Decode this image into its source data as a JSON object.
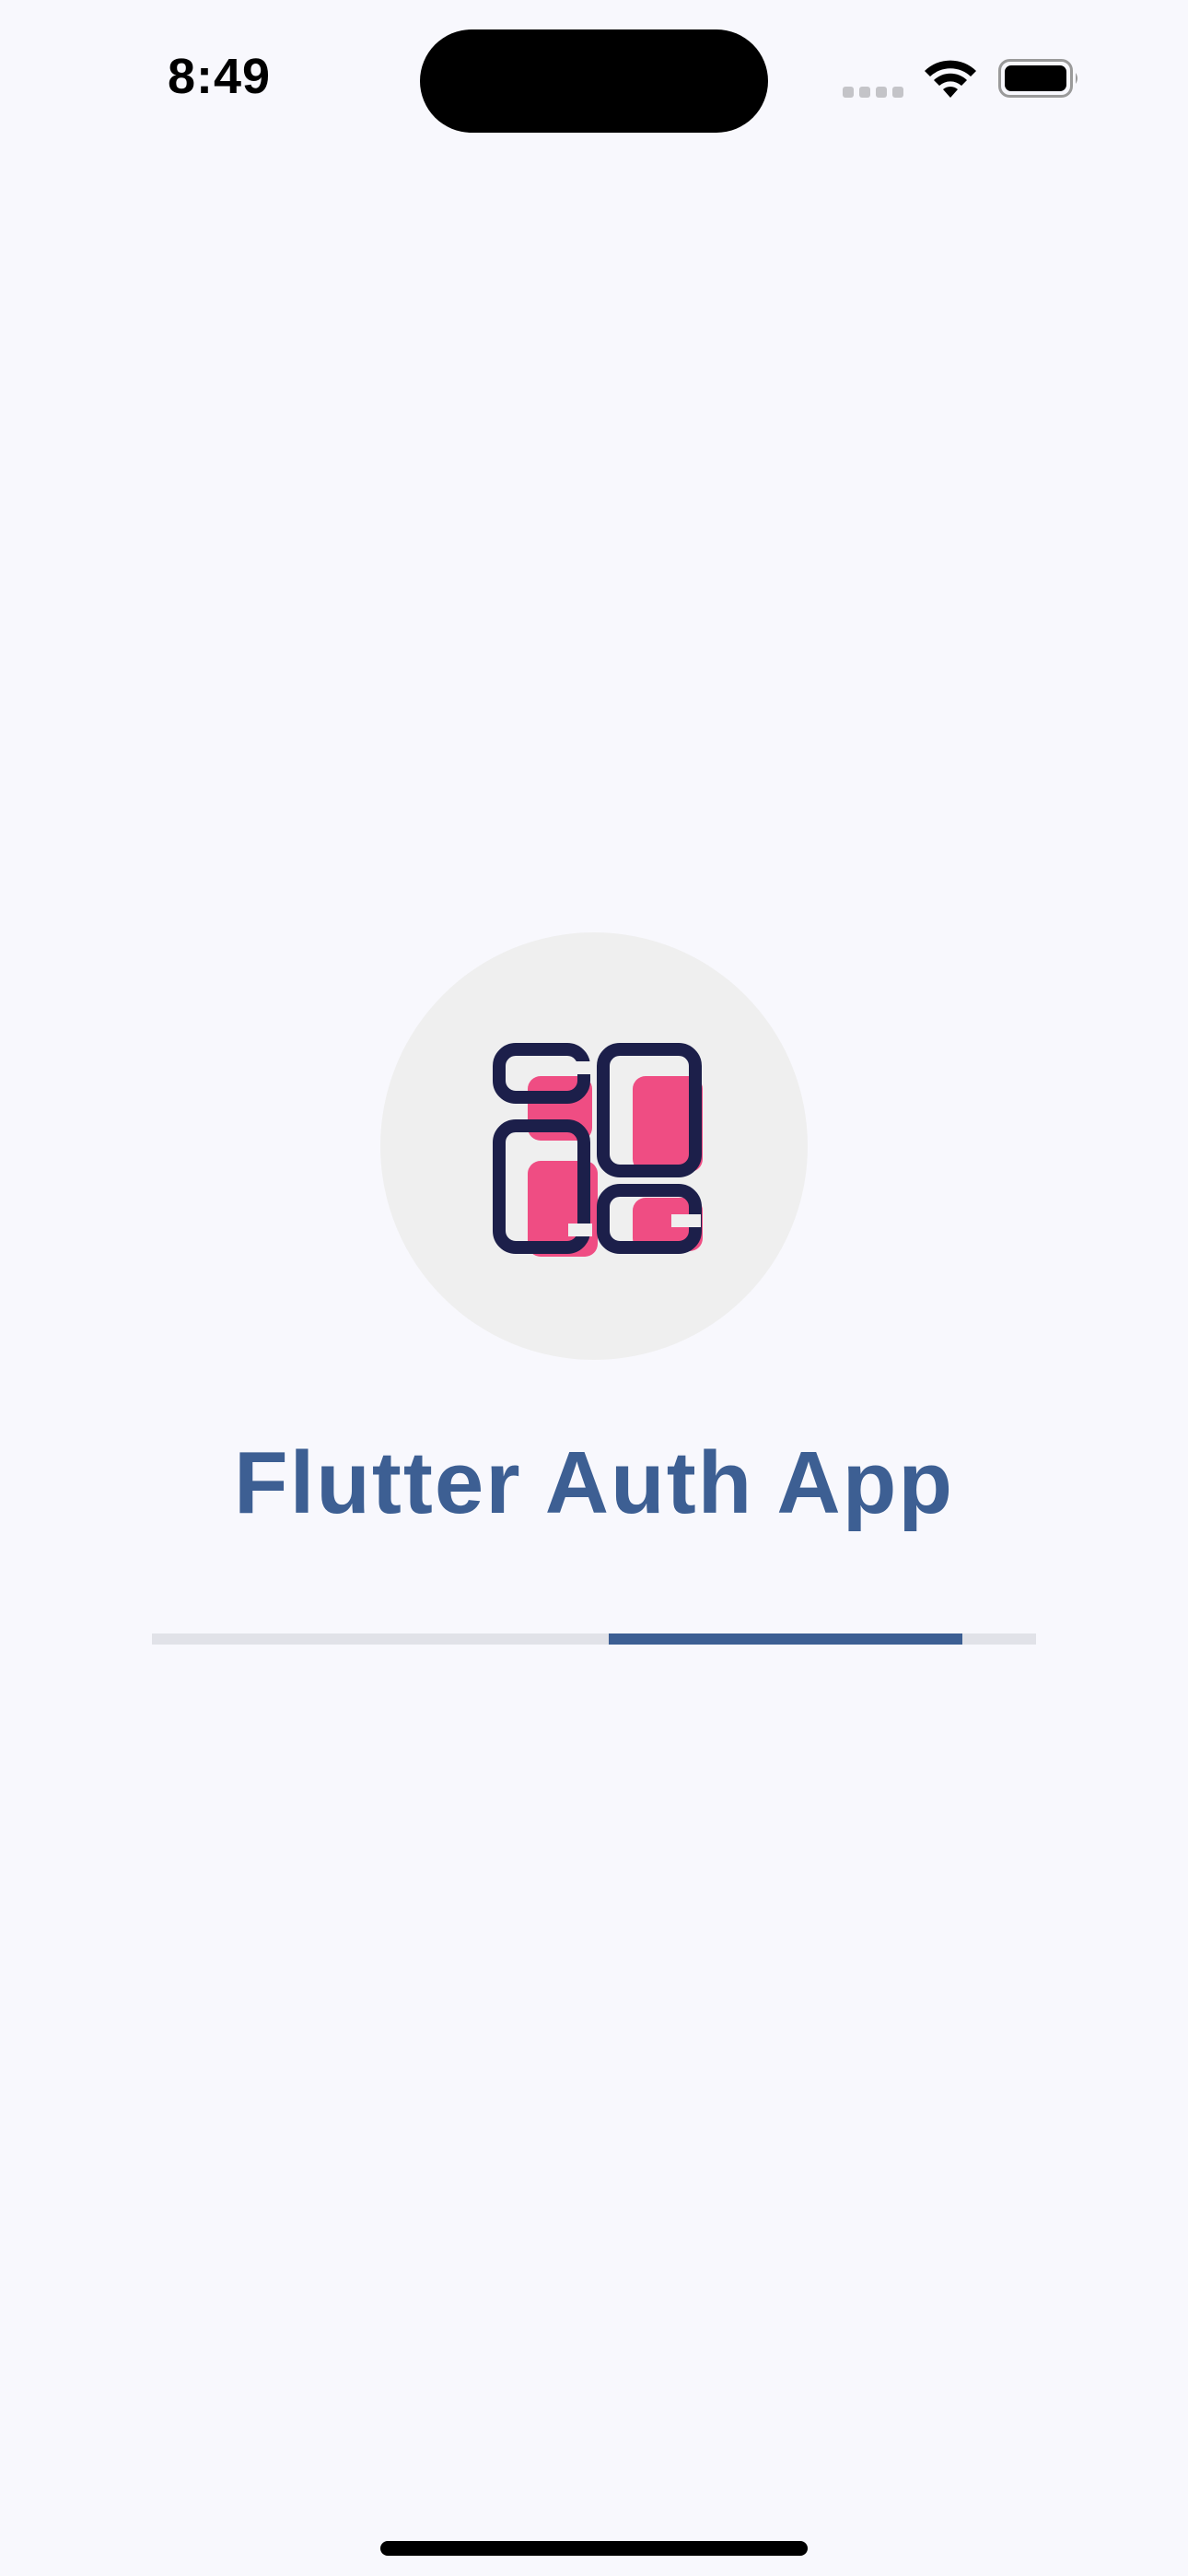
{
  "status_bar": {
    "time": "8:49",
    "icons": [
      "cellular-signal-icon",
      "wifi-icon",
      "battery-icon"
    ]
  },
  "splash": {
    "logo_icon": "app-logo-icon",
    "title": "Flutter Auth App",
    "progress": {
      "start_fraction": 0.517,
      "end_fraction": 0.917
    }
  },
  "colors": {
    "background": "#f8f8fd",
    "brand_blue": "#3d5f93",
    "logo_dark": "#1c1f4a",
    "logo_pink": "#ef3f79",
    "circle": "#efefef",
    "track": "#e1e2e8"
  }
}
